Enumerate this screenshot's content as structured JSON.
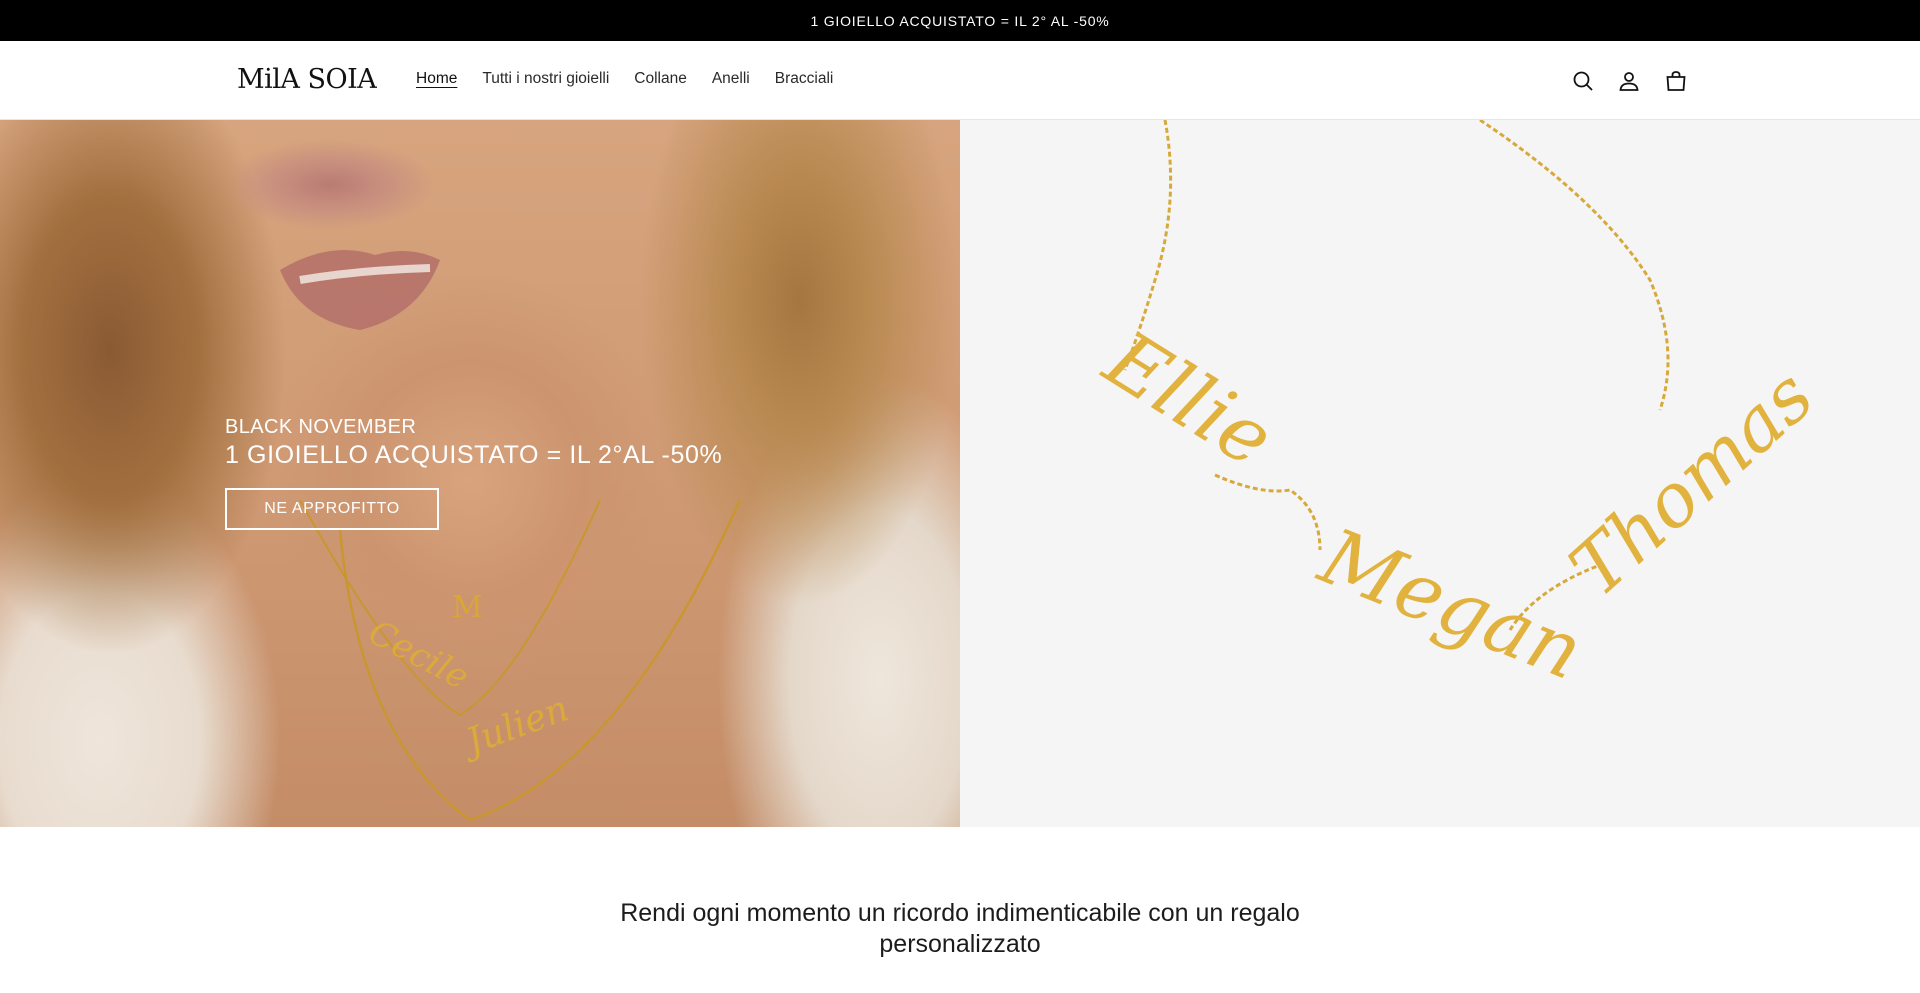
{
  "announcement": {
    "text": "1 GIOIELLO ACQUISTATO = IL 2° AL -50%"
  },
  "header": {
    "logo": "MilA SOIA",
    "nav": [
      {
        "label": "Home",
        "active": true
      },
      {
        "label": "Tutti i nostri gioielli"
      },
      {
        "label": "Collane"
      },
      {
        "label": "Anelli"
      },
      {
        "label": "Bracciali"
      }
    ],
    "icons": [
      "search-icon",
      "account-icon",
      "cart-icon"
    ]
  },
  "hero": {
    "eyebrow": "BLACK NOVEMBER",
    "heading": "1 GIOIELLO ACQUISTATO = IL 2°AL -50%",
    "button_label": "NE APPROFITTO",
    "left_pendants": [
      "M",
      "Cecile",
      "Julien"
    ],
    "right_names": [
      "Ellie",
      "Megan",
      "Thomas"
    ]
  },
  "intro": {
    "text": "Rendi ogni momento un ricordo indimenticabile con un regalo personalizzato"
  },
  "colors": {
    "announcement_bg": "#000000",
    "gold": "#e2b23f",
    "button_border": "#ffffff"
  }
}
